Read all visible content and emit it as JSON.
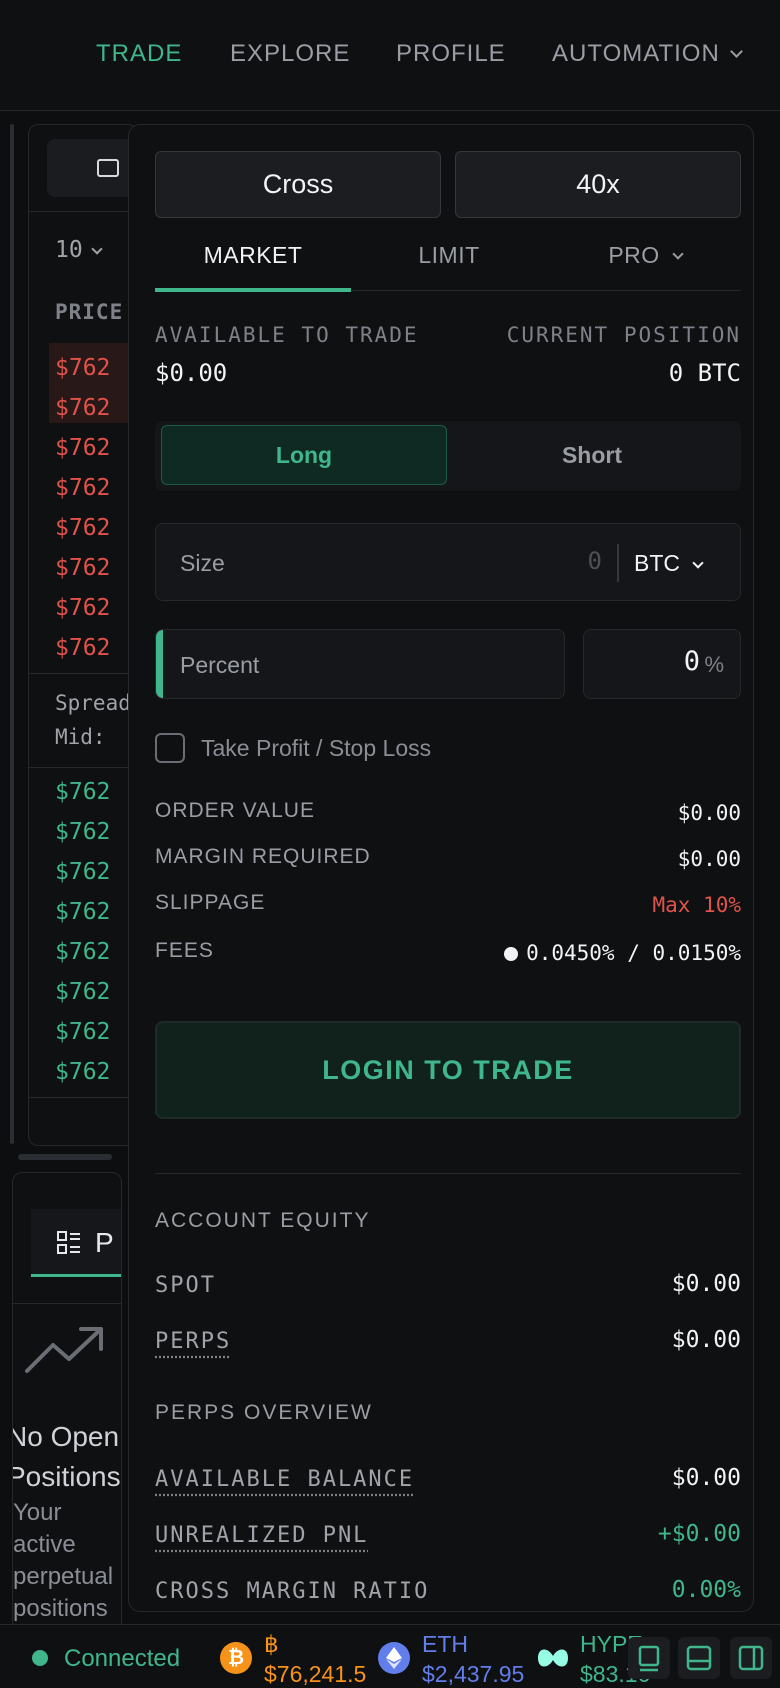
{
  "nav": {
    "items": [
      {
        "label": "TRADE",
        "active": true
      },
      {
        "label": "EXPLORE"
      },
      {
        "label": "PROFILE"
      },
      {
        "label": "AUTOMATION"
      }
    ]
  },
  "orderbook": {
    "depth_value": "10",
    "header": "PRICE",
    "asks": [
      "$762",
      "$762",
      "$762",
      "$762",
      "$762",
      "$762",
      "$762",
      "$762"
    ],
    "spread_label": "Spread",
    "mid_label": "Mid:",
    "bids": [
      "$762",
      "$762",
      "$762",
      "$762",
      "$762",
      "$762",
      "$762",
      "$762"
    ]
  },
  "positions": {
    "tab_label": "P",
    "empty_title_1": "No Open",
    "empty_title_2": "Positions",
    "empty_sub": [
      "Your",
      "active",
      "perpetual",
      "positions"
    ]
  },
  "trade": {
    "margin_mode": "Cross",
    "leverage": "40x",
    "order_tabs": [
      {
        "label": "MARKET",
        "active": true
      },
      {
        "label": "LIMIT"
      },
      {
        "label": "PRO"
      }
    ],
    "available_label": "AVAILABLE TO TRADE",
    "available_value": "$0.00",
    "position_label": "CURRENT POSITION",
    "position_value": "0 BTC",
    "long_label": "Long",
    "short_label": "Short",
    "size_label": "Size",
    "size_placeholder": "0",
    "size_unit": "BTC",
    "percent_label": "Percent",
    "percent_value": "0",
    "percent_unit": "%",
    "tpsl_label": "Take Profit / Stop Loss",
    "order_value_label": "ORDER VALUE",
    "order_value": "$0.00",
    "margin_label": "MARGIN REQUIRED",
    "margin_value": "$0.00",
    "slippage_label": "SLIPPAGE",
    "slippage_value": "Max 10%",
    "fees_label": "FEES",
    "fees_value": "0.0450% / 0.0150%",
    "login_label": "LOGIN TO TRADE"
  },
  "account": {
    "equity_title": "ACCOUNT EQUITY",
    "spot_label": "SPOT",
    "spot_value": "$0.00",
    "perps_label": "PERPS",
    "perps_value": "$0.00",
    "overview_title": "PERPS OVERVIEW",
    "balance_label": "AVAILABLE BALANCE",
    "balance_value": "$0.00",
    "pnl_label": "UNREALIZED PNL",
    "pnl_value": "+$0.00",
    "ratio_label": "CROSS MARGIN RATIO",
    "ratio_value": "0.00%"
  },
  "status": {
    "connection": "Connected",
    "tickers": [
      {
        "symbol": "฿",
        "price": "$76,241.5",
        "color": "#f7931a",
        "icon": "bitcoin-icon"
      },
      {
        "symbol": "ETH",
        "price": "$2,437.95",
        "color": "#627eea",
        "icon": "ethereum-icon"
      },
      {
        "symbol": "HYPE",
        "price": "$83.16",
        "color": "#97fce4",
        "icon": "hype-icon"
      }
    ]
  },
  "colors": {
    "accent": "#3fb68b",
    "negative": "#e0534a",
    "background": "#0d0e10"
  }
}
